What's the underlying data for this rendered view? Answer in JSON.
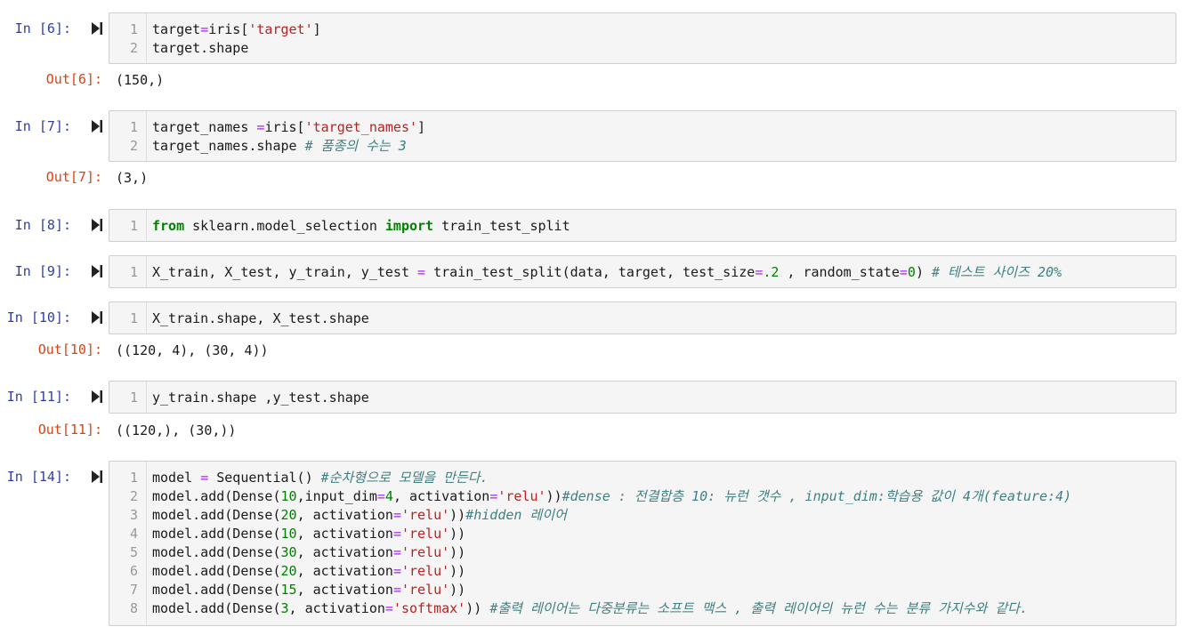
{
  "cells": [
    {
      "in_prompt": "In [6]:",
      "out_prompt": "Out[6]:",
      "output": "(150,)",
      "lines": [
        {
          "num": "1",
          "tokens": [
            {
              "t": "target"
            },
            {
              "t": "=",
              "c": "op"
            },
            {
              "t": "iris["
            },
            {
              "t": "'target'",
              "c": "str"
            },
            {
              "t": "]"
            }
          ]
        },
        {
          "num": "2",
          "tokens": [
            {
              "t": "target.shape"
            }
          ]
        }
      ]
    },
    {
      "in_prompt": "In [7]:",
      "out_prompt": "Out[7]:",
      "output": "(3,)",
      "lines": [
        {
          "num": "1",
          "tokens": [
            {
              "t": "target_names "
            },
            {
              "t": "=",
              "c": "op"
            },
            {
              "t": "iris["
            },
            {
              "t": "'target_names'",
              "c": "str"
            },
            {
              "t": "]"
            }
          ]
        },
        {
          "num": "2",
          "tokens": [
            {
              "t": "target_names.shape "
            },
            {
              "t": "# 품종의 수는 3",
              "c": "cm"
            }
          ]
        }
      ]
    },
    {
      "in_prompt": "In [8]:",
      "lines": [
        {
          "num": "1",
          "tokens": [
            {
              "t": "from",
              "c": "kw"
            },
            {
              "t": " sklearn.model_selection "
            },
            {
              "t": "import",
              "c": "kw"
            },
            {
              "t": " train_test_split"
            }
          ]
        }
      ]
    },
    {
      "in_prompt": "In [9]:",
      "lines": [
        {
          "num": "1",
          "tokens": [
            {
              "t": "X_train, X_test, y_train, y_test "
            },
            {
              "t": "=",
              "c": "op"
            },
            {
              "t": " train_test_split(data, target, test_size"
            },
            {
              "t": "=",
              "c": "op"
            },
            {
              "t": ".2",
              "c": "num"
            },
            {
              "t": " , random_state"
            },
            {
              "t": "=",
              "c": "op"
            },
            {
              "t": "0",
              "c": "num"
            },
            {
              "t": ") "
            },
            {
              "t": "# 테스트 사이즈 20%",
              "c": "cm"
            }
          ]
        }
      ]
    },
    {
      "in_prompt": "In [10]:",
      "out_prompt": "Out[10]:",
      "output": "((120, 4), (30, 4))",
      "lines": [
        {
          "num": "1",
          "tokens": [
            {
              "t": "X_train.shape, X_test.shape"
            }
          ]
        }
      ]
    },
    {
      "in_prompt": "In [11]:",
      "out_prompt": "Out[11]:",
      "output": "((120,), (30,))",
      "lines": [
        {
          "num": "1",
          "tokens": [
            {
              "t": "y_train.shape ,y_test.shape"
            }
          ]
        }
      ]
    },
    {
      "in_prompt": "In [14]:",
      "lines": [
        {
          "num": "1",
          "tokens": [
            {
              "t": "model "
            },
            {
              "t": "=",
              "c": "op"
            },
            {
              "t": " Sequential() "
            },
            {
              "t": "#순차형으로 모델을 만든다.",
              "c": "cm"
            }
          ]
        },
        {
          "num": "2",
          "tokens": [
            {
              "t": "model.add(Dense("
            },
            {
              "t": "10",
              "c": "num"
            },
            {
              "t": ",input_dim"
            },
            {
              "t": "=",
              "c": "op"
            },
            {
              "t": "4",
              "c": "num"
            },
            {
              "t": ", activation"
            },
            {
              "t": "=",
              "c": "op"
            },
            {
              "t": "'relu'",
              "c": "str"
            },
            {
              "t": "))"
            },
            {
              "t": "#dense : 전결합층 10: 뉴런 갯수 , input_dim:학습용 값이 4개(feature:4)",
              "c": "cm"
            }
          ]
        },
        {
          "num": "3",
          "tokens": [
            {
              "t": "model.add(Dense("
            },
            {
              "t": "20",
              "c": "num"
            },
            {
              "t": ", activation"
            },
            {
              "t": "=",
              "c": "op"
            },
            {
              "t": "'relu'",
              "c": "str"
            },
            {
              "t": "))"
            },
            {
              "t": "#hidden 레이어",
              "c": "cm"
            }
          ]
        },
        {
          "num": "4",
          "tokens": [
            {
              "t": "model.add(Dense("
            },
            {
              "t": "10",
              "c": "num"
            },
            {
              "t": ", activation"
            },
            {
              "t": "=",
              "c": "op"
            },
            {
              "t": "'relu'",
              "c": "str"
            },
            {
              "t": "))"
            }
          ]
        },
        {
          "num": "5",
          "tokens": [
            {
              "t": "model.add(Dense("
            },
            {
              "t": "30",
              "c": "num"
            },
            {
              "t": ", activation"
            },
            {
              "t": "=",
              "c": "op"
            },
            {
              "t": "'relu'",
              "c": "str"
            },
            {
              "t": "))"
            }
          ]
        },
        {
          "num": "6",
          "tokens": [
            {
              "t": "model.add(Dense("
            },
            {
              "t": "20",
              "c": "num"
            },
            {
              "t": ", activation"
            },
            {
              "t": "=",
              "c": "op"
            },
            {
              "t": "'relu'",
              "c": "str"
            },
            {
              "t": "))"
            }
          ]
        },
        {
          "num": "7",
          "tokens": [
            {
              "t": "model.add(Dense("
            },
            {
              "t": "15",
              "c": "num"
            },
            {
              "t": ", activation"
            },
            {
              "t": "=",
              "c": "op"
            },
            {
              "t": "'relu'",
              "c": "str"
            },
            {
              "t": "))"
            }
          ]
        },
        {
          "num": "8",
          "tokens": [
            {
              "t": "model.add(Dense("
            },
            {
              "t": "3",
              "c": "num"
            },
            {
              "t": ", activation"
            },
            {
              "t": "=",
              "c": "op"
            },
            {
              "t": "'softmax'",
              "c": "str"
            },
            {
              "t": ")) "
            },
            {
              "t": "#출력 레이어는 다중분류는 소프트 맥스 , 출력 레이어의 뉴런 수는 분류 가지수와 같다.",
              "c": "cm"
            }
          ]
        }
      ]
    }
  ]
}
